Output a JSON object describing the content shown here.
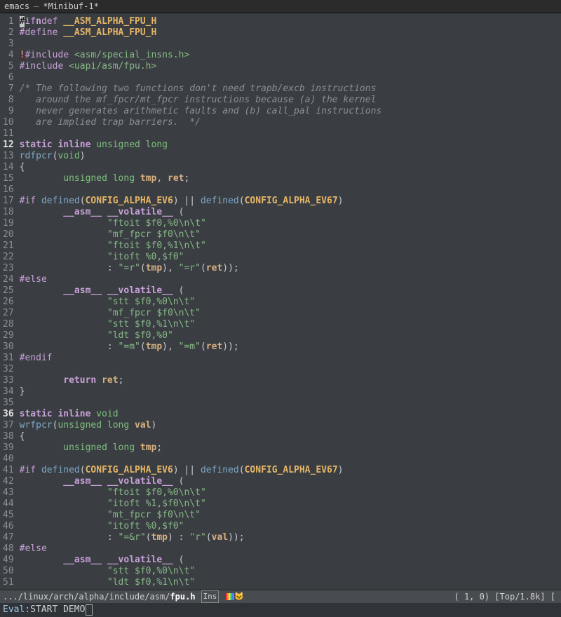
{
  "titlebar": {
    "app": "emacs",
    "dash": "–",
    "buffer": "*Minibuf-1*"
  },
  "gutter": {
    "bold_lines": [
      12,
      36
    ]
  },
  "code": [
    {
      "n": 1,
      "seg": [
        [
          "cursor",
          "#"
        ],
        [
          "pp",
          "if"
        ],
        [
          "kw",
          "n"
        ],
        [
          "pp",
          "def "
        ],
        [
          "macro",
          "__ASM_ALPHA_FPU_H"
        ]
      ]
    },
    {
      "n": 2,
      "seg": [
        [
          "pp",
          "#define "
        ],
        [
          "macro",
          "__ASM_ALPHA_FPU_H"
        ]
      ]
    },
    {
      "n": 3,
      "seg": [
        [
          "",
          ""
        ]
      ]
    },
    {
      "n": 4,
      "seg": [
        [
          "bang",
          "!"
        ],
        [
          "pp",
          "#include "
        ],
        [
          "inc",
          "<asm/special_insns.h>"
        ]
      ]
    },
    {
      "n": 5,
      "seg": [
        [
          "pp",
          "#include "
        ],
        [
          "inc",
          "<uapi/asm/fpu.h>"
        ]
      ]
    },
    {
      "n": 6,
      "seg": [
        [
          "",
          ""
        ]
      ]
    },
    {
      "n": 7,
      "seg": [
        [
          "cmt",
          "/* The following two functions don't need trapb/excb instructions"
        ]
      ]
    },
    {
      "n": 8,
      "seg": [
        [
          "cmt",
          "   around the mf_fpcr/mt_fpcr instructions because (a) the kernel"
        ]
      ]
    },
    {
      "n": 9,
      "seg": [
        [
          "cmt",
          "   never generates arithmetic faults and (b) call_pal instructions"
        ]
      ]
    },
    {
      "n": 10,
      "seg": [
        [
          "cmt",
          "   are implied trap barriers.  */"
        ]
      ]
    },
    {
      "n": 11,
      "seg": [
        [
          "",
          ""
        ]
      ]
    },
    {
      "n": 12,
      "seg": [
        [
          "kw",
          "static inline "
        ],
        [
          "type",
          "unsigned long"
        ]
      ]
    },
    {
      "n": 13,
      "seg": [
        [
          "fn",
          "rdfpcr"
        ],
        [
          "punct",
          "("
        ],
        [
          "type",
          "void"
        ],
        [
          "punct",
          ")"
        ]
      ]
    },
    {
      "n": 14,
      "seg": [
        [
          "punct",
          "{"
        ]
      ]
    },
    {
      "n": 15,
      "seg": [
        [
          "",
          "        "
        ],
        [
          "type",
          "unsigned long "
        ],
        [
          "var",
          "tmp"
        ],
        [
          "punct",
          ", "
        ],
        [
          "var",
          "ret"
        ],
        [
          "punct",
          ";"
        ]
      ]
    },
    {
      "n": 16,
      "seg": [
        [
          "",
          ""
        ]
      ]
    },
    {
      "n": 17,
      "seg": [
        [
          "pp",
          "#if "
        ],
        [
          "fn",
          "defined"
        ],
        [
          "punct",
          "("
        ],
        [
          "macro",
          "CONFIG_ALPHA_EV6"
        ],
        [
          "punct",
          ") || "
        ],
        [
          "fn",
          "defined"
        ],
        [
          "punct",
          "("
        ],
        [
          "macro",
          "CONFIG_ALPHA_EV67"
        ],
        [
          "punct",
          ")"
        ]
      ]
    },
    {
      "n": 18,
      "seg": [
        [
          "",
          "        "
        ],
        [
          "kw",
          "__asm__ __volatile__"
        ],
        [
          "punct",
          " ("
        ]
      ]
    },
    {
      "n": 19,
      "seg": [
        [
          "",
          "                "
        ],
        [
          "str",
          "\"ftoit $f0,%0\\n\\t\""
        ]
      ]
    },
    {
      "n": 20,
      "seg": [
        [
          "",
          "                "
        ],
        [
          "str",
          "\"mf_fpcr $f0\\n\\t\""
        ]
      ]
    },
    {
      "n": 21,
      "seg": [
        [
          "",
          "                "
        ],
        [
          "str",
          "\"ftoit $f0,%1\\n\\t\""
        ]
      ]
    },
    {
      "n": 22,
      "seg": [
        [
          "",
          "                "
        ],
        [
          "str",
          "\"itoft %0,$f0\""
        ]
      ]
    },
    {
      "n": 23,
      "seg": [
        [
          "",
          "                "
        ],
        [
          "punct",
          ": "
        ],
        [
          "str",
          "\"=r\""
        ],
        [
          "punct",
          "("
        ],
        [
          "var",
          "tmp"
        ],
        [
          "punct",
          "), "
        ],
        [
          "str",
          "\"=r\""
        ],
        [
          "punct",
          "("
        ],
        [
          "var",
          "ret"
        ],
        [
          "punct",
          "));"
        ]
      ]
    },
    {
      "n": 24,
      "seg": [
        [
          "pp",
          "#else"
        ]
      ]
    },
    {
      "n": 25,
      "seg": [
        [
          "",
          "        "
        ],
        [
          "kw",
          "__asm__ __volatile__"
        ],
        [
          "punct",
          " ("
        ]
      ]
    },
    {
      "n": 26,
      "seg": [
        [
          "",
          "                "
        ],
        [
          "str",
          "\"stt $f0,%0\\n\\t\""
        ]
      ]
    },
    {
      "n": 27,
      "seg": [
        [
          "",
          "                "
        ],
        [
          "str",
          "\"mf_fpcr $f0\\n\\t\""
        ]
      ]
    },
    {
      "n": 28,
      "seg": [
        [
          "",
          "                "
        ],
        [
          "str",
          "\"stt $f0,%1\\n\\t\""
        ]
      ]
    },
    {
      "n": 29,
      "seg": [
        [
          "",
          "                "
        ],
        [
          "str",
          "\"ldt $f0,%0\""
        ]
      ]
    },
    {
      "n": 30,
      "seg": [
        [
          "",
          "                "
        ],
        [
          "punct",
          ": "
        ],
        [
          "str",
          "\"=m\""
        ],
        [
          "punct",
          "("
        ],
        [
          "var",
          "tmp"
        ],
        [
          "punct",
          "), "
        ],
        [
          "str",
          "\"=m\""
        ],
        [
          "punct",
          "("
        ],
        [
          "var",
          "ret"
        ],
        [
          "punct",
          "));"
        ]
      ]
    },
    {
      "n": 31,
      "seg": [
        [
          "pp",
          "#endif"
        ]
      ]
    },
    {
      "n": 32,
      "seg": [
        [
          "",
          ""
        ]
      ]
    },
    {
      "n": 33,
      "seg": [
        [
          "",
          "        "
        ],
        [
          "kw",
          "return "
        ],
        [
          "var",
          "ret"
        ],
        [
          "punct",
          ";"
        ]
      ]
    },
    {
      "n": 34,
      "seg": [
        [
          "punct",
          "}"
        ]
      ]
    },
    {
      "n": 35,
      "seg": [
        [
          "",
          ""
        ]
      ]
    },
    {
      "n": 36,
      "seg": [
        [
          "kw",
          "static inline "
        ],
        [
          "type",
          "void"
        ]
      ]
    },
    {
      "n": 37,
      "seg": [
        [
          "fn",
          "wrfpcr"
        ],
        [
          "punct",
          "("
        ],
        [
          "type",
          "unsigned long "
        ],
        [
          "var",
          "val"
        ],
        [
          "punct",
          ")"
        ]
      ]
    },
    {
      "n": 38,
      "seg": [
        [
          "punct",
          "{"
        ]
      ]
    },
    {
      "n": 39,
      "seg": [
        [
          "",
          "        "
        ],
        [
          "type",
          "unsigned long "
        ],
        [
          "var",
          "tmp"
        ],
        [
          "punct",
          ";"
        ]
      ]
    },
    {
      "n": 40,
      "seg": [
        [
          "",
          ""
        ]
      ]
    },
    {
      "n": 41,
      "seg": [
        [
          "pp",
          "#if "
        ],
        [
          "fn",
          "defined"
        ],
        [
          "punct",
          "("
        ],
        [
          "macro",
          "CONFIG_ALPHA_EV6"
        ],
        [
          "punct",
          ") || "
        ],
        [
          "fn",
          "defined"
        ],
        [
          "punct",
          "("
        ],
        [
          "macro",
          "CONFIG_ALPHA_EV67"
        ],
        [
          "punct",
          ")"
        ]
      ]
    },
    {
      "n": 42,
      "seg": [
        [
          "",
          "        "
        ],
        [
          "kw",
          "__asm__ __volatile__"
        ],
        [
          "punct",
          " ("
        ]
      ]
    },
    {
      "n": 43,
      "seg": [
        [
          "",
          "                "
        ],
        [
          "str",
          "\"ftoit $f0,%0\\n\\t\""
        ]
      ]
    },
    {
      "n": 44,
      "seg": [
        [
          "",
          "                "
        ],
        [
          "str",
          "\"itoft %1,$f0\\n\\t\""
        ]
      ]
    },
    {
      "n": 45,
      "seg": [
        [
          "",
          "                "
        ],
        [
          "str",
          "\"mt_fpcr $f0\\n\\t\""
        ]
      ]
    },
    {
      "n": 46,
      "seg": [
        [
          "",
          "                "
        ],
        [
          "str",
          "\"itoft %0,$f0\""
        ]
      ]
    },
    {
      "n": 47,
      "seg": [
        [
          "",
          "                "
        ],
        [
          "punct",
          ": "
        ],
        [
          "str",
          "\"=&r\""
        ],
        [
          "punct",
          "("
        ],
        [
          "var",
          "tmp"
        ],
        [
          "punct",
          ") : "
        ],
        [
          "str",
          "\"r\""
        ],
        [
          "punct",
          "("
        ],
        [
          "var",
          "val"
        ],
        [
          "punct",
          "));"
        ]
      ]
    },
    {
      "n": 48,
      "seg": [
        [
          "pp",
          "#else"
        ]
      ]
    },
    {
      "n": 49,
      "seg": [
        [
          "",
          "        "
        ],
        [
          "kw",
          "__asm__ __volatile__"
        ],
        [
          "punct",
          " ("
        ]
      ]
    },
    {
      "n": 50,
      "seg": [
        [
          "",
          "                "
        ],
        [
          "str",
          "\"stt $f0,%0\\n\\t\""
        ]
      ]
    },
    {
      "n": 51,
      "seg": [
        [
          "",
          "                "
        ],
        [
          "str",
          "\"ldt $f0,%1\\n\\t\""
        ]
      ]
    }
  ],
  "modeline": {
    "path": ".../linux/arch/alpha/include/asm/",
    "fname": "fpu.h",
    "ins": "Ins",
    "pos": "( 1, 0) [Top/1.8k] ["
  },
  "nyan_colors": [
    "#ff3030",
    "#ff9030",
    "#ffe030",
    "#60e060",
    "#4080ff",
    "#a060ff"
  ],
  "minibuf": {
    "prompt": "Eval: ",
    "input": "START DEMO"
  }
}
